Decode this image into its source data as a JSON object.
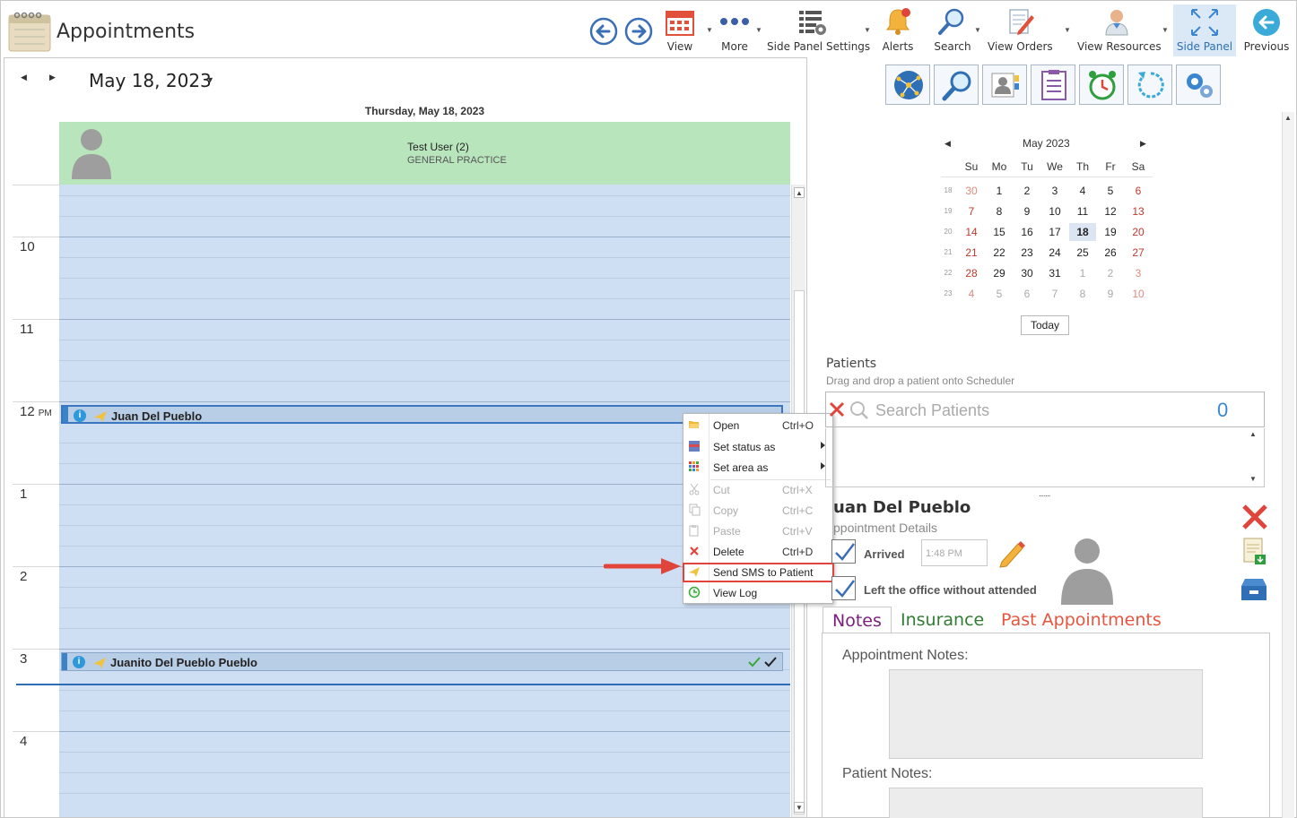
{
  "header": {
    "title": "Appointments",
    "toolbar": [
      {
        "id": "view",
        "label": "View",
        "icon": "calendar-icon"
      },
      {
        "id": "more",
        "label": "More",
        "icon": "more-dots-icon"
      },
      {
        "id": "side_panel_settings",
        "label": "Side Panel Settings",
        "icon": "panel-settings-icon"
      },
      {
        "id": "alerts",
        "label": "Alerts",
        "icon": "bell-icon"
      },
      {
        "id": "search",
        "label": "Search",
        "icon": "magnifier-icon"
      },
      {
        "id": "view_orders",
        "label": "View Orders",
        "icon": "document-pencil-icon"
      },
      {
        "id": "view_resources",
        "label": "View Resources",
        "icon": "doctor-icon"
      },
      {
        "id": "side_panel",
        "label": "Side Panel",
        "icon": "expand-arrows-icon"
      },
      {
        "id": "previous",
        "label": "Previous",
        "icon": "back-circle-icon"
      }
    ],
    "accent_color": "#3a86d0"
  },
  "scheduler": {
    "date_title": "May 18, 2023",
    "day_header": "Thursday, May 18, 2023",
    "resource": {
      "name": "Test User (2)",
      "specialty": "GENERAL PRACTICE",
      "color": "#b9e5bd"
    },
    "hours": [
      {
        "label": "10",
        "suffix": ""
      },
      {
        "label": "11",
        "suffix": ""
      },
      {
        "label": "12",
        "suffix": "PM"
      },
      {
        "label": "1",
        "suffix": ""
      },
      {
        "label": "2",
        "suffix": ""
      },
      {
        "label": "3",
        "suffix": ""
      },
      {
        "label": "4",
        "suffix": ""
      }
    ],
    "appointments": [
      {
        "patient": "Juan Del Pueblo",
        "selected": true
      },
      {
        "patient": "Juanito Del Pueblo Pueblo",
        "selected": false
      }
    ]
  },
  "context_menu": {
    "items": [
      {
        "label": "Open",
        "shortcut": "Ctrl+O",
        "icon": "folder-open-icon",
        "enabled": true
      },
      {
        "label": "Set status as",
        "shortcut": "",
        "icon": "status-icon",
        "enabled": true,
        "submenu": true
      },
      {
        "label": "Set area as",
        "shortcut": "",
        "icon": "area-grid-icon",
        "enabled": true,
        "submenu": true
      },
      {
        "label": "Cut",
        "shortcut": "Ctrl+X",
        "icon": "scissors-icon",
        "enabled": false
      },
      {
        "label": "Copy",
        "shortcut": "Ctrl+C",
        "icon": "copy-icon",
        "enabled": false
      },
      {
        "label": "Paste",
        "shortcut": "Ctrl+V",
        "icon": "paste-icon",
        "enabled": false
      },
      {
        "label": "Delete",
        "shortcut": "Ctrl+D",
        "icon": "delete-x-icon",
        "enabled": true
      },
      {
        "label": "Send SMS to Patient",
        "shortcut": "",
        "icon": "send-sms-icon",
        "enabled": true,
        "highlighted": true
      },
      {
        "label": "View Log",
        "shortcut": "",
        "icon": "log-icon",
        "enabled": true
      }
    ],
    "highlight_color": "#e0443a"
  },
  "mini_calendar": {
    "month": "May 2023",
    "dow": [
      "Su",
      "Mo",
      "Tu",
      "We",
      "Th",
      "Fr",
      "Sa"
    ],
    "weeks": [
      {
        "wk": "18",
        "days": [
          [
            "30",
            "o"
          ],
          [
            "1",
            ""
          ],
          [
            "2",
            ""
          ],
          [
            "3",
            ""
          ],
          [
            "4",
            ""
          ],
          [
            "5",
            ""
          ],
          [
            "6",
            ""
          ]
        ]
      },
      {
        "wk": "19",
        "days": [
          [
            "7",
            ""
          ],
          [
            "8",
            ""
          ],
          [
            "9",
            ""
          ],
          [
            "10",
            ""
          ],
          [
            "11",
            ""
          ],
          [
            "12",
            ""
          ],
          [
            "13",
            ""
          ]
        ]
      },
      {
        "wk": "20",
        "days": [
          [
            "14",
            ""
          ],
          [
            "15",
            ""
          ],
          [
            "16",
            ""
          ],
          [
            "17",
            ""
          ],
          [
            "18",
            "t"
          ],
          [
            "19",
            ""
          ],
          [
            "20",
            ""
          ]
        ]
      },
      {
        "wk": "21",
        "days": [
          [
            "21",
            ""
          ],
          [
            "22",
            ""
          ],
          [
            "23",
            ""
          ],
          [
            "24",
            ""
          ],
          [
            "25",
            ""
          ],
          [
            "26",
            ""
          ],
          [
            "27",
            ""
          ]
        ]
      },
      {
        "wk": "22",
        "days": [
          [
            "28",
            ""
          ],
          [
            "29",
            ""
          ],
          [
            "30",
            ""
          ],
          [
            "31",
            ""
          ],
          [
            "1",
            "o"
          ],
          [
            "2",
            "o"
          ],
          [
            "3",
            "o"
          ]
        ]
      },
      {
        "wk": "23",
        "days": [
          [
            "4",
            "o"
          ],
          [
            "5",
            "o"
          ],
          [
            "6",
            "o"
          ],
          [
            "7",
            "o"
          ],
          [
            "8",
            "o"
          ],
          [
            "9",
            "o"
          ],
          [
            "10",
            "o"
          ]
        ]
      }
    ],
    "today_label": "Today"
  },
  "patients": {
    "header": "Patients",
    "subheader": "Drag and drop a patient onto Scheduler",
    "search_placeholder": "Search Patients",
    "count": "0"
  },
  "details": {
    "name": "uan Del Pueblo",
    "subtitle": "ppointment Details",
    "arrived_label": "Arrived",
    "arrived_time": "1:48 PM",
    "left_label": "Left the office without attended",
    "tabs": [
      {
        "label": "Notes",
        "color": "#7a1f7a"
      },
      {
        "label": "Insurance",
        "color": "#2e7d32"
      },
      {
        "label": "Past Appointments",
        "color": "#e8553f"
      }
    ],
    "appointment_notes_label": "Appointment Notes:",
    "patient_notes_label": "Patient Notes:"
  }
}
